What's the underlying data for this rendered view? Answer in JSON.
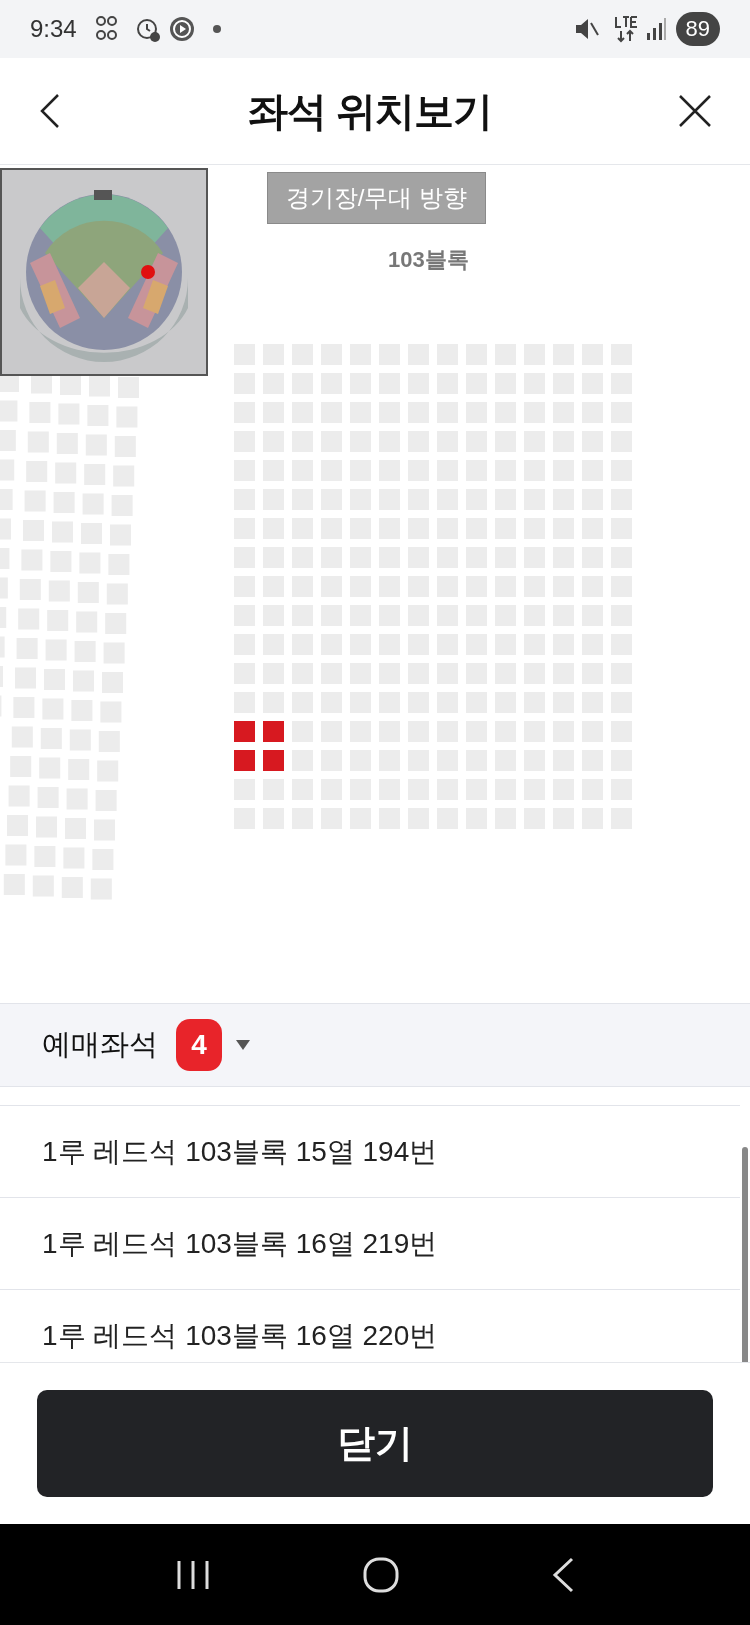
{
  "status_bar": {
    "time": "9:34",
    "battery": "89"
  },
  "header": {
    "title": "좌석 위치보기"
  },
  "seat_map": {
    "direction_label": "경기장/무대 방향",
    "block_label": "103블록",
    "seat_rows": [
      {
        "seats": [
          {
            "selected": false
          },
          {
            "selected": false
          },
          {
            "selected": false
          },
          {
            "selected": false
          },
          {
            "selected": false
          },
          {
            "selected": false
          },
          {
            "selected": false
          },
          {
            "selected": false
          },
          {
            "selected": false
          },
          {
            "selected": false
          },
          {
            "selected": false
          },
          {
            "selected": false
          },
          {
            "selected": false
          },
          {
            "selected": false
          }
        ]
      },
      {
        "seats": [
          {
            "selected": false
          },
          {
            "selected": false
          },
          {
            "selected": false
          },
          {
            "selected": false
          },
          {
            "selected": false
          },
          {
            "selected": false
          },
          {
            "selected": false
          },
          {
            "selected": false
          },
          {
            "selected": false
          },
          {
            "selected": false
          },
          {
            "selected": false
          },
          {
            "selected": false
          },
          {
            "selected": false
          },
          {
            "selected": false
          }
        ]
      },
      {
        "seats": [
          {
            "selected": false
          },
          {
            "selected": false
          },
          {
            "selected": false
          },
          {
            "selected": false
          },
          {
            "selected": false
          },
          {
            "selected": false
          },
          {
            "selected": false
          },
          {
            "selected": false
          },
          {
            "selected": false
          },
          {
            "selected": false
          },
          {
            "selected": false
          },
          {
            "selected": false
          },
          {
            "selected": false
          },
          {
            "selected": false
          }
        ]
      },
      {
        "seats": [
          {
            "selected": false
          },
          {
            "selected": false
          },
          {
            "selected": false
          },
          {
            "selected": false
          },
          {
            "selected": false
          },
          {
            "selected": false
          },
          {
            "selected": false
          },
          {
            "selected": false
          },
          {
            "selected": false
          },
          {
            "selected": false
          },
          {
            "selected": false
          },
          {
            "selected": false
          },
          {
            "selected": false
          },
          {
            "selected": false
          }
        ]
      },
      {
        "seats": [
          {
            "selected": false
          },
          {
            "selected": false
          },
          {
            "selected": false
          },
          {
            "selected": false
          },
          {
            "selected": false
          },
          {
            "selected": false
          },
          {
            "selected": false
          },
          {
            "selected": false
          },
          {
            "selected": false
          },
          {
            "selected": false
          },
          {
            "selected": false
          },
          {
            "selected": false
          },
          {
            "selected": false
          },
          {
            "selected": false
          }
        ]
      },
      {
        "seats": [
          {
            "selected": false
          },
          {
            "selected": false
          },
          {
            "selected": false
          },
          {
            "selected": false
          },
          {
            "selected": false
          },
          {
            "selected": false
          },
          {
            "selected": false
          },
          {
            "selected": false
          },
          {
            "selected": false
          },
          {
            "selected": false
          },
          {
            "selected": false
          },
          {
            "selected": false
          },
          {
            "selected": false
          },
          {
            "selected": false
          }
        ]
      },
      {
        "seats": [
          {
            "selected": false
          },
          {
            "selected": false
          },
          {
            "selected": false
          },
          {
            "selected": false
          },
          {
            "selected": false
          },
          {
            "selected": false
          },
          {
            "selected": false
          },
          {
            "selected": false
          },
          {
            "selected": false
          },
          {
            "selected": false
          },
          {
            "selected": false
          },
          {
            "selected": false
          },
          {
            "selected": false
          },
          {
            "selected": false
          }
        ]
      },
      {
        "seats": [
          {
            "selected": false
          },
          {
            "selected": false
          },
          {
            "selected": false
          },
          {
            "selected": false
          },
          {
            "selected": false
          },
          {
            "selected": false
          },
          {
            "selected": false
          },
          {
            "selected": false
          },
          {
            "selected": false
          },
          {
            "selected": false
          },
          {
            "selected": false
          },
          {
            "selected": false
          },
          {
            "selected": false
          },
          {
            "selected": false
          }
        ]
      },
      {
        "seats": [
          {
            "selected": false
          },
          {
            "selected": false
          },
          {
            "selected": false
          },
          {
            "selected": false
          },
          {
            "selected": false
          },
          {
            "selected": false
          },
          {
            "selected": false
          },
          {
            "selected": false
          },
          {
            "selected": false
          },
          {
            "selected": false
          },
          {
            "selected": false
          },
          {
            "selected": false
          },
          {
            "selected": false
          },
          {
            "selected": false
          }
        ]
      },
      {
        "seats": [
          {
            "selected": false
          },
          {
            "selected": false
          },
          {
            "selected": false
          },
          {
            "selected": false
          },
          {
            "selected": false
          },
          {
            "selected": false
          },
          {
            "selected": false
          },
          {
            "selected": false
          },
          {
            "selected": false
          },
          {
            "selected": false
          },
          {
            "selected": false
          },
          {
            "selected": false
          },
          {
            "selected": false
          },
          {
            "selected": false
          }
        ]
      },
      {
        "seats": [
          {
            "selected": false
          },
          {
            "selected": false
          },
          {
            "selected": false
          },
          {
            "selected": false
          },
          {
            "selected": false
          },
          {
            "selected": false
          },
          {
            "selected": false
          },
          {
            "selected": false
          },
          {
            "selected": false
          },
          {
            "selected": false
          },
          {
            "selected": false
          },
          {
            "selected": false
          },
          {
            "selected": false
          },
          {
            "selected": false
          }
        ]
      },
      {
        "seats": [
          {
            "selected": false
          },
          {
            "selected": false
          },
          {
            "selected": false
          },
          {
            "selected": false
          },
          {
            "selected": false
          },
          {
            "selected": false
          },
          {
            "selected": false
          },
          {
            "selected": false
          },
          {
            "selected": false
          },
          {
            "selected": false
          },
          {
            "selected": false
          },
          {
            "selected": false
          },
          {
            "selected": false
          },
          {
            "selected": false
          }
        ]
      },
      {
        "seats": [
          {
            "selected": false
          },
          {
            "selected": false
          },
          {
            "selected": false
          },
          {
            "selected": false
          },
          {
            "selected": false
          },
          {
            "selected": false
          },
          {
            "selected": false
          },
          {
            "selected": false
          },
          {
            "selected": false
          },
          {
            "selected": false
          },
          {
            "selected": false
          },
          {
            "selected": false
          },
          {
            "selected": false
          },
          {
            "selected": false
          }
        ]
      },
      {
        "seats": [
          {
            "selected": true
          },
          {
            "selected": true
          },
          {
            "selected": false
          },
          {
            "selected": false
          },
          {
            "selected": false
          },
          {
            "selected": false
          },
          {
            "selected": false
          },
          {
            "selected": false
          },
          {
            "selected": false
          },
          {
            "selected": false
          },
          {
            "selected": false
          },
          {
            "selected": false
          },
          {
            "selected": false
          },
          {
            "selected": false
          }
        ]
      },
      {
        "seats": [
          {
            "selected": true
          },
          {
            "selected": true
          },
          {
            "selected": false
          },
          {
            "selected": false
          },
          {
            "selected": false
          },
          {
            "selected": false
          },
          {
            "selected": false
          },
          {
            "selected": false
          },
          {
            "selected": false
          },
          {
            "selected": false
          },
          {
            "selected": false
          },
          {
            "selected": false
          },
          {
            "selected": false
          },
          {
            "selected": false
          }
        ]
      },
      {
        "seats": [
          {
            "selected": false
          },
          {
            "selected": false
          },
          {
            "selected": false
          },
          {
            "selected": false
          },
          {
            "selected": false
          },
          {
            "selected": false
          },
          {
            "selected": false
          },
          {
            "selected": false
          },
          {
            "selected": false
          },
          {
            "selected": false
          },
          {
            "selected": false
          },
          {
            "selected": false
          },
          {
            "selected": false
          },
          {
            "selected": false
          }
        ]
      },
      {
        "seats": [
          {
            "selected": false
          },
          {
            "selected": false
          },
          {
            "selected": false
          },
          {
            "selected": false
          },
          {
            "selected": false
          },
          {
            "selected": false
          },
          {
            "selected": false
          },
          {
            "selected": false
          },
          {
            "selected": false
          },
          {
            "selected": false
          },
          {
            "selected": false
          },
          {
            "selected": false
          },
          {
            "selected": false
          },
          {
            "selected": false
          }
        ]
      }
    ]
  },
  "booked_seats": {
    "label": "예매좌석",
    "count": "4",
    "items": [
      "1루 레드석 103블록 15열 194번",
      "1루 레드석 103블록 16열 219번",
      "1루 레드석 103블록 16열 220번"
    ]
  },
  "close_button": "닫기"
}
